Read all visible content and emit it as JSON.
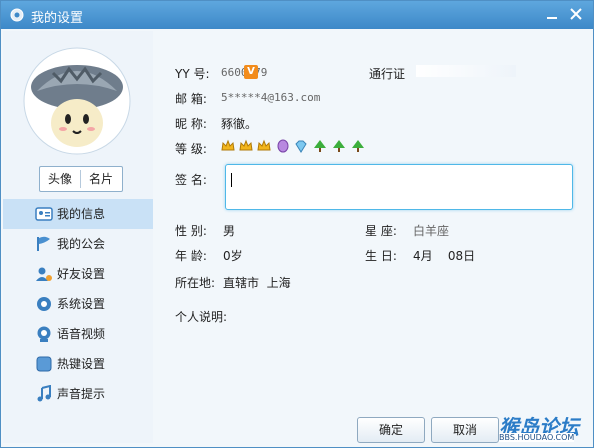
{
  "window": {
    "title": "我的设置"
  },
  "avatar_buttons": {
    "avatar": "头像",
    "card": "名片"
  },
  "sidebar": {
    "items": [
      {
        "label": "我的信息",
        "active": true
      },
      {
        "label": "我的公会"
      },
      {
        "label": "好友设置"
      },
      {
        "label": "系统设置"
      },
      {
        "label": "语音视频"
      },
      {
        "label": "热键设置"
      },
      {
        "label": "声音提示"
      }
    ]
  },
  "profile": {
    "yy_label": "YY  号:",
    "yy_value": "6600779",
    "vip_badge": "V",
    "pass_label": "通行证",
    "email_label": "邮  箱:",
    "email_value": "5*****4@163.com",
    "nick_label": "昵  称:",
    "nick_value": "豩徹。",
    "level_label": "等  级:",
    "sig_label": "签  名:",
    "sig_value": "",
    "gender_label": "性  别:",
    "gender_value": "男",
    "zodiac_label": "星  座:",
    "zodiac_value": "白羊座",
    "age_label": "年  龄:",
    "age_value": "0岁",
    "birthday_label": "生  日:",
    "birthday_value": "4月    08日",
    "location_label": "所在地:",
    "location_value": "直辖市  上海",
    "about_label": "个人说明:"
  },
  "buttons": {
    "ok": "确定",
    "cancel": "取消"
  },
  "watermark": {
    "main": "猴岛论坛",
    "url": "BBS.HOUDAO.COM"
  },
  "colors": {
    "title_bar": "#3d88c8",
    "active_nav": "#c9e1f6",
    "accent_border": "#4fb8e8"
  }
}
